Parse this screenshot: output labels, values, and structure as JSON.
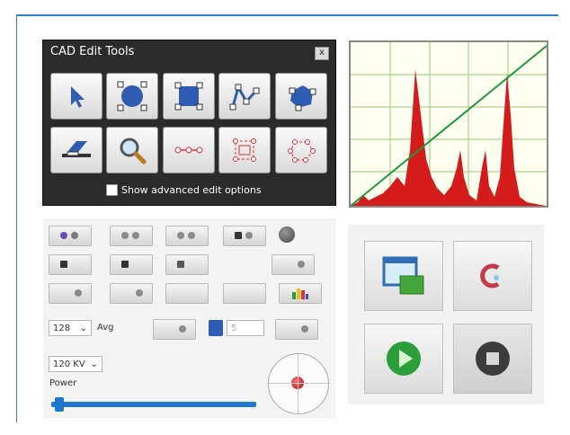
{
  "cad_panel": {
    "title": "CAD Edit Tools",
    "close_glyph": "x",
    "advanced_label": "Show advanced edit options",
    "tools": [
      {
        "icon": "select-arrow-icon"
      },
      {
        "icon": "circle-icon"
      },
      {
        "icon": "rectangle-icon"
      },
      {
        "icon": "polyline-icon"
      },
      {
        "icon": "polygon-icon"
      },
      {
        "icon": "eraser-icon"
      },
      {
        "icon": "magnifier-icon"
      },
      {
        "icon": "point-chain-icon"
      },
      {
        "icon": "select-rect-icon"
      },
      {
        "icon": "select-poly-icon"
      }
    ]
  },
  "histogram": {
    "colors": {
      "fill": "#d41c1c",
      "line": "#1e9a3a",
      "grid": "#9bc47d",
      "background": "#fffff0"
    }
  },
  "controls": {
    "avg_value": "128",
    "avg_label": "Avg",
    "kv_value": "120 KV",
    "power_label": "Power",
    "field_value": "5",
    "power_level": 0.02,
    "accent": "#1f77d0"
  },
  "apps": {
    "items": [
      {
        "icon": "window-folder-icon"
      },
      {
        "icon": "red-loop-icon"
      },
      {
        "icon": "play-icon"
      },
      {
        "icon": "stop-icon"
      }
    ]
  }
}
